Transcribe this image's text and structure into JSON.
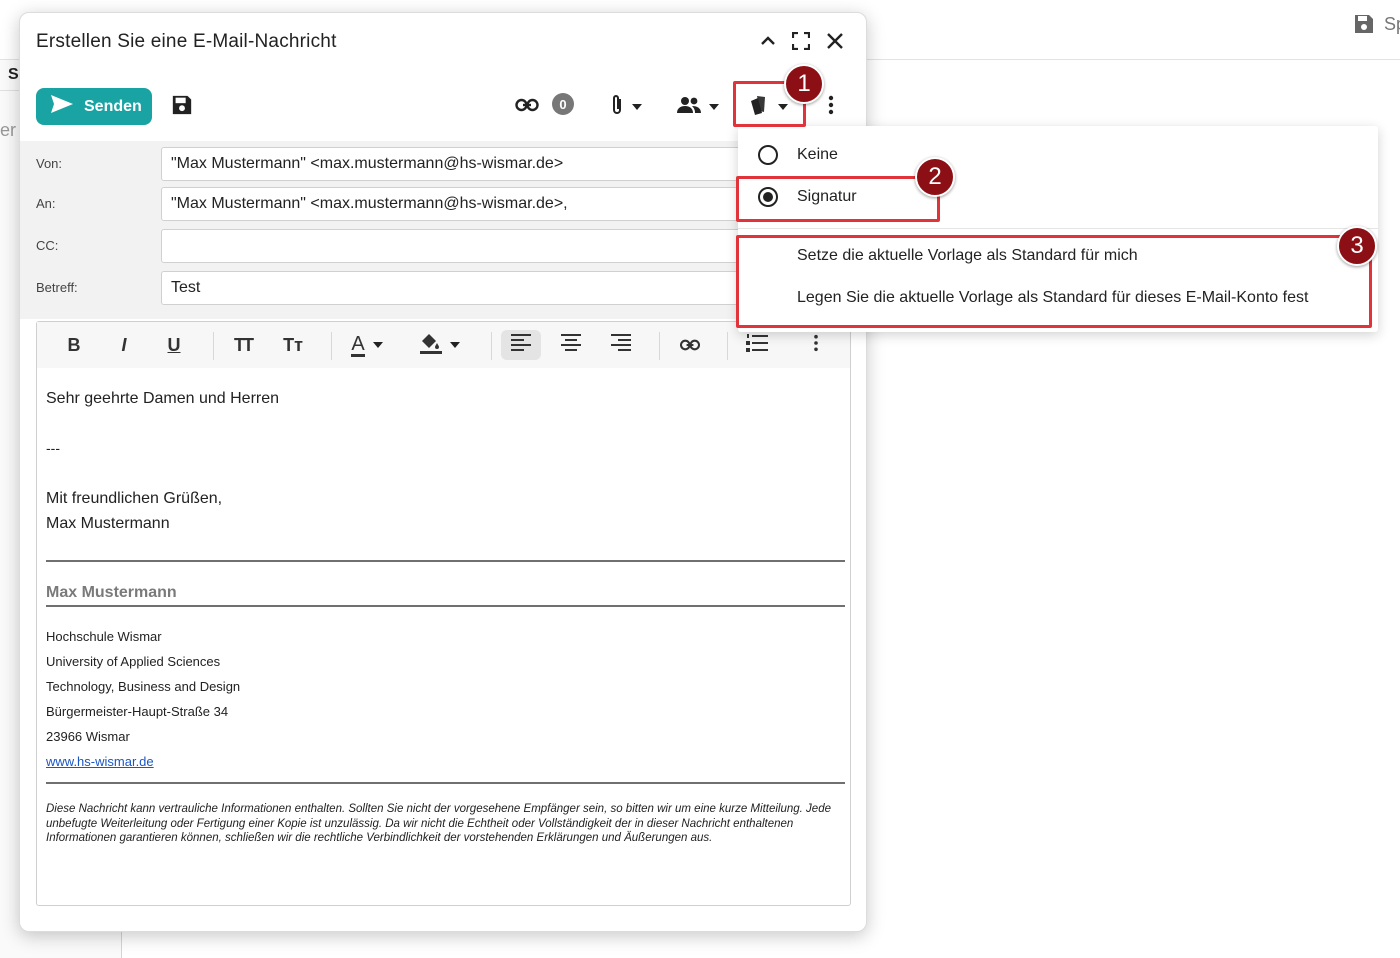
{
  "background": {
    "left_letter": "S",
    "left_partial": "er",
    "top_right_partial": "Sp"
  },
  "compose": {
    "title": "Erstellen Sie eine E-Mail-Nachricht",
    "send_label": "Senden",
    "link_count": "0",
    "fields": {
      "from_label": "Von:",
      "from_value": "\"Max Mustermann\" <max.mustermann@hs-wismar.de>",
      "to_label": "An:",
      "to_value": "\"Max Mustermann\" <max.mustermann@hs-wismar.de>,",
      "cc_label": "CC:",
      "cc_value": "",
      "subject_label": "Betreff:",
      "subject_value": "Test"
    },
    "editor_toolbar": {
      "bold": "B",
      "italic": "I",
      "underline": "U",
      "font_size": "TT",
      "text_case": "Tт",
      "font_color": "A"
    },
    "body": {
      "greeting": "Sehr geehrte Damen und Herren",
      "separator": "---",
      "closing": "Mit freundlichen Grüßen,",
      "closing_name": "Max Mustermann"
    },
    "signature": {
      "name": "Max Mustermann",
      "lines": [
        "Hochschule Wismar",
        "University of Applied Sciences",
        "Technology, Business and Design",
        "Bürgermeister-Haupt-Straße 34",
        "23966 Wismar"
      ],
      "website": "www.hs-wismar.de",
      "disclaimer": "Diese Nachricht kann vertrauliche Informationen enthalten. Sollten Sie nicht der vorgesehene Empfänger sein, so bitten wir um eine kurze Mitteilung. Jede unbefugte Weiterleitung oder Fertigung einer Kopie ist unzulässig. Da wir nicht die Echtheit oder Vollständigkeit der in dieser Nachricht enthaltenen Informationen garantieren können, schließen wir die rechtliche Verbindlichkeit der vorstehenden Erklärungen und Äußerungen aus."
    }
  },
  "dropdown": {
    "options": [
      {
        "label": "Keine",
        "selected": false
      },
      {
        "label": "Signatur",
        "selected": true
      }
    ],
    "actions": [
      "Setze die aktuelle Vorlage als Standard für mich",
      "Legen Sie die aktuelle Vorlage als Standard für dieses E-Mail-Konto fest"
    ]
  },
  "annotations": {
    "marker_1": "1",
    "marker_2": "2",
    "marker_3": "3",
    "highlight_color": "#e0333a",
    "marker_color": "#8b0f14"
  },
  "colors": {
    "accent": "#1aa3a3",
    "link": "#1a56c4"
  }
}
